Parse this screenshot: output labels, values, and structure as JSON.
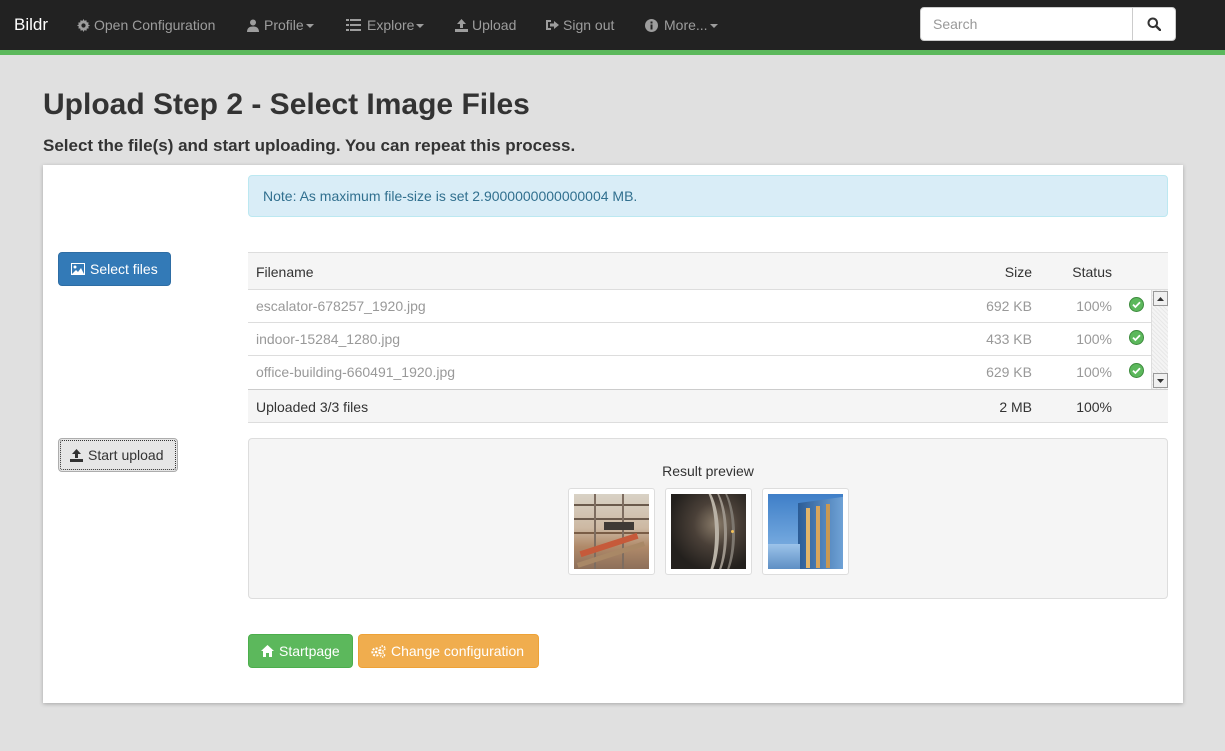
{
  "navbar": {
    "brand": "Bildr",
    "items": [
      {
        "label": "Open Configuration",
        "icon": "gear-icon",
        "dropdown": false
      },
      {
        "label": "Profile",
        "icon": "user-icon",
        "dropdown": true
      },
      {
        "label": "Explore",
        "icon": "list-icon",
        "dropdown": true
      },
      {
        "label": "Upload",
        "icon": "upload-icon",
        "dropdown": false
      },
      {
        "label": "Sign out",
        "icon": "sign-out-icon",
        "dropdown": false
      },
      {
        "label": "More...",
        "icon": "info-icon",
        "dropdown": true
      }
    ],
    "search": {
      "placeholder": "Search",
      "value": ""
    },
    "accent_color": "#5cb85c"
  },
  "page": {
    "title": "Upload Step 2 - Select Image Files",
    "subtitle": "Select the file(s) and start uploading. You can repeat this process."
  },
  "alert": {
    "text": "Note: As maximum file-size is set 2.9000000000000004 MB."
  },
  "buttons": {
    "select_files": "Select files",
    "start_upload": "Start upload",
    "startpage": "Startpage",
    "change_configuration": "Change configuration"
  },
  "file_table": {
    "headers": {
      "filename": "Filename",
      "size": "Size",
      "status": "Status"
    },
    "rows": [
      {
        "filename": "escalator-678257_1920.jpg",
        "size": "692 KB",
        "status": "100%",
        "done": true
      },
      {
        "filename": "indoor-15284_1280.jpg",
        "size": "433 KB",
        "status": "100%",
        "done": true
      },
      {
        "filename": "office-building-660491_1920.jpg",
        "size": "629 KB",
        "status": "100%",
        "done": true
      }
    ],
    "footer": {
      "summary": "Uploaded 3/3 files",
      "size": "2 MB",
      "status": "100%"
    }
  },
  "preview": {
    "label": "Result preview",
    "images": [
      "escalator-678257_1920.jpg",
      "indoor-15284_1280.jpg",
      "office-building-660491_1920.jpg"
    ]
  }
}
